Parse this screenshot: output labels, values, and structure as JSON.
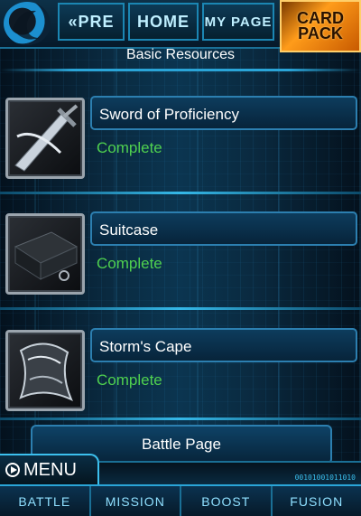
{
  "header": {
    "pre_label": "«PRE",
    "home_label": "HOME",
    "mypage_label": "MY PAGE",
    "cardpack_line1": "CARD",
    "cardpack_line2": "PACK"
  },
  "section_title": "Basic Resources",
  "items": [
    {
      "name": "Sword of Proficiency",
      "status": "Complete",
      "icon": "sword-icon"
    },
    {
      "name": "Suitcase",
      "status": "Complete",
      "icon": "suitcase-icon"
    },
    {
      "name": "Storm's Cape",
      "status": "Complete",
      "icon": "cape-icon"
    }
  ],
  "battle_page_label": "Battle Page",
  "menu": {
    "label": "MENU",
    "tabs": [
      "BATTLE",
      "MISSION",
      "BOOST",
      "FUSION"
    ]
  },
  "colors": {
    "accent": "#2aa5d8",
    "status_complete": "#4fd04f",
    "card_pack": "#ff9c1a"
  }
}
